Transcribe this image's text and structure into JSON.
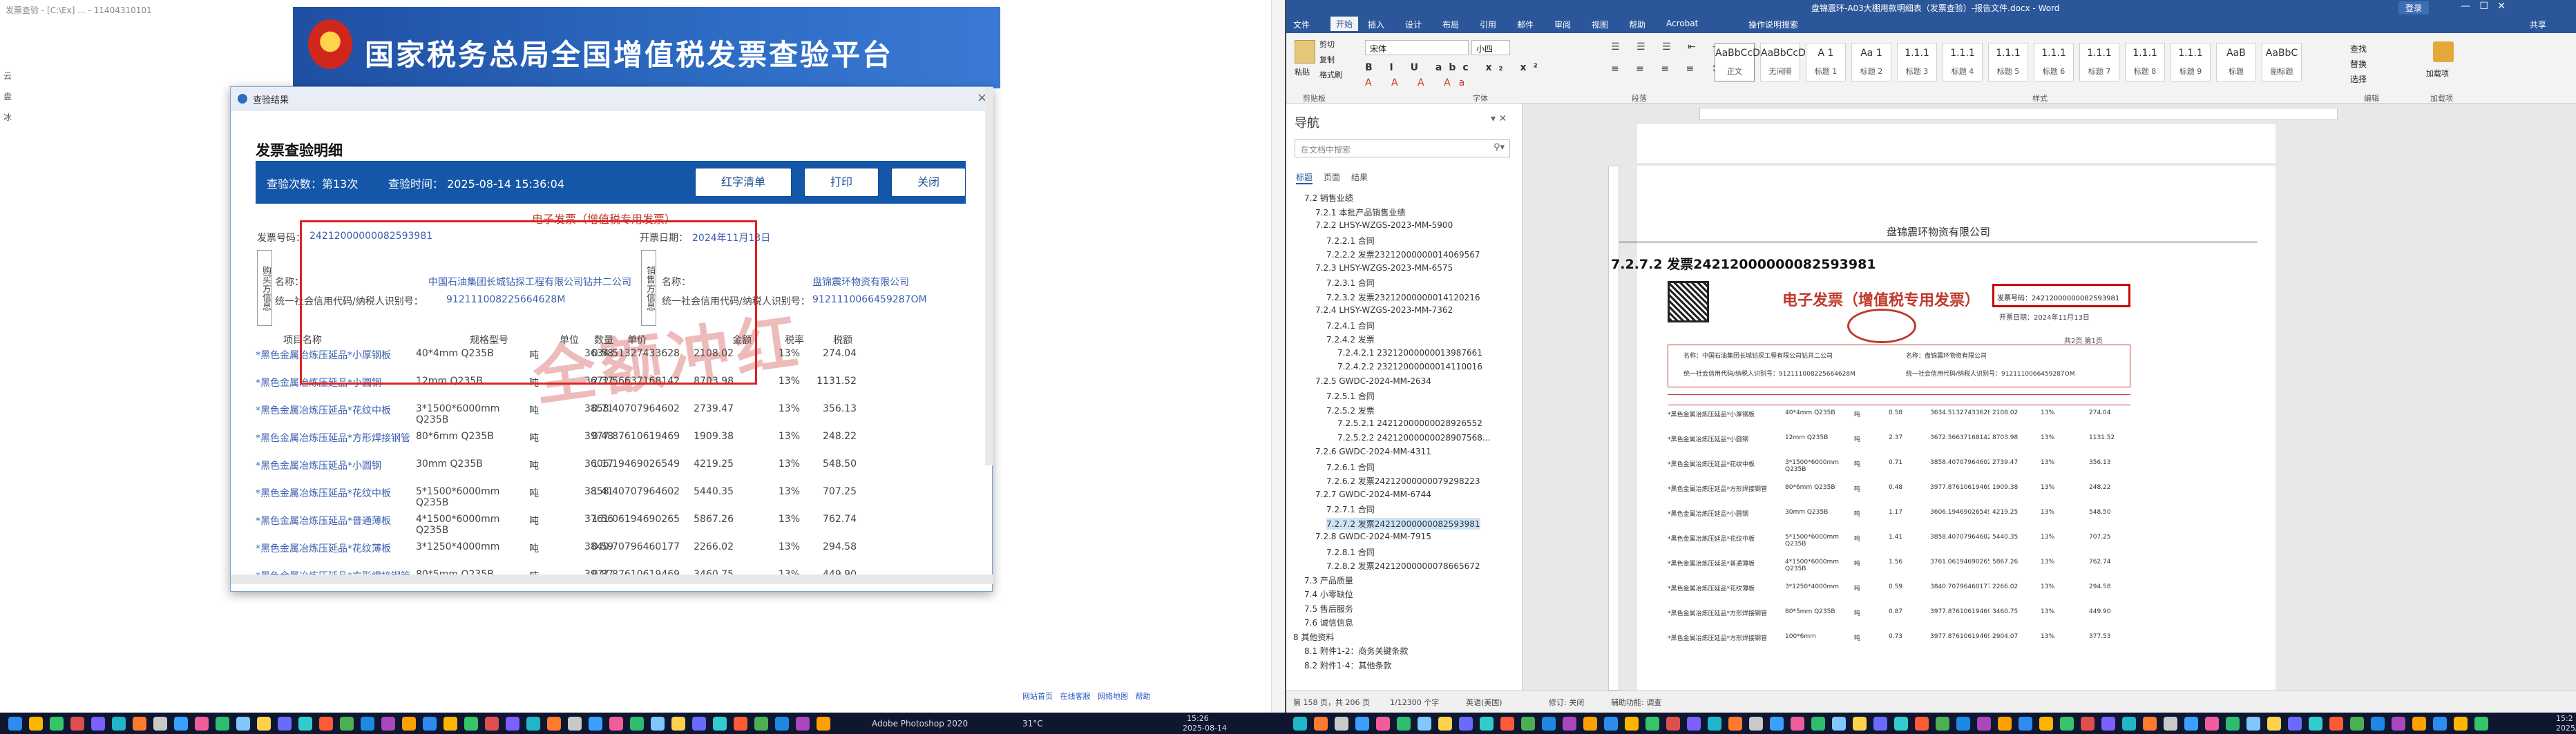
{
  "left_screen": {
    "snippet_text": "发票查验 - [C:\\Ex] ... - 11404310101",
    "side_icons": [
      "云",
      "盘",
      "冰"
    ],
    "banner_title": "国家税务总局全国增值税发票查验平台",
    "dialog": {
      "window_title": "查验结果",
      "close_glyph": "×",
      "heading": "发票查验明细",
      "check_count": "查验次数：第13次",
      "check_time": "查验时间：  2025-08-14 15:36:04",
      "buttons": [
        "红字清单",
        "打印",
        "关闭"
      ],
      "invoice": {
        "title": "电子发票（增值税专用发票）",
        "number_label": "发票号码：",
        "number": "24212000000082593981",
        "date_label": "开票日期：",
        "date": "2024年11月13日",
        "buyer_section": "购买方信息",
        "seller_section": "销售方信息",
        "name_label": "名称：",
        "buyer_name": "中国石油集团长城钻探工程有限公司钻井二公司",
        "seller_name": "盘锦震环物资有限公司",
        "tax_label": "统一社会信用代码/纳税人识别号：",
        "buyer_tax_id": "912111008225664628M",
        "seller_tax_id": "9121110066459287OM",
        "stamp": "全额冲红",
        "columns": [
          "项目名称",
          "规格型号",
          "单位",
          "数量",
          "单价",
          "金额",
          "税率",
          "税额"
        ],
        "rows": [
          {
            "name": "*黑色金属冶炼压延品*小厚钢板",
            "spec": "40*4mm Q235B",
            "unit": "吨",
            "qty": "0.58",
            "price": "3634.51327433628",
            "amount": "2108.02",
            "rate": "13%",
            "tax": "274.04"
          },
          {
            "name": "*黑色金属冶炼压延品*小圆钢",
            "spec": "12mm Q235B",
            "unit": "吨",
            "qty": "2.37",
            "price": "3672.56637168142",
            "amount": "8703.98",
            "rate": "13%",
            "tax": "1131.52"
          },
          {
            "name": "*黑色金属冶炼压延品*花纹中板",
            "spec": "3*1500*6000mm Q235B",
            "unit": "吨",
            "qty": "0.71",
            "price": "3858.40707964602",
            "amount": "2739.47",
            "rate": "13%",
            "tax": "356.13"
          },
          {
            "name": "*黑色金属冶炼压延品*方形焊接钢管",
            "spec": "80*6mm Q235B",
            "unit": "吨",
            "qty": "0.48",
            "price": "3977.87610619469",
            "amount": "1909.38",
            "rate": "13%",
            "tax": "248.22"
          },
          {
            "name": "*黑色金属冶炼压延品*小圆钢",
            "spec": "30mm Q235B",
            "unit": "吨",
            "qty": "1.17",
            "price": "3606.19469026549",
            "amount": "4219.25",
            "rate": "13%",
            "tax": "548.50"
          },
          {
            "name": "*黑色金属冶炼压延品*花纹中板",
            "spec": "5*1500*6000mm Q235B",
            "unit": "吨",
            "qty": "1.41",
            "price": "3858.40707964602",
            "amount": "5440.35",
            "rate": "13%",
            "tax": "707.25"
          },
          {
            "name": "*黑色金属冶炼压延品*普通薄板",
            "spec": "4*1500*6000mm Q235B",
            "unit": "吨",
            "qty": "1.56",
            "price": "3761.06194690265",
            "amount": "5867.26",
            "rate": "13%",
            "tax": "762.74"
          },
          {
            "name": "*黑色金属冶炼压延品*花纹薄板",
            "spec": "3*1250*4000mm",
            "unit": "吨",
            "qty": "0.59",
            "price": "3840.70796460177",
            "amount": "2266.02",
            "rate": "13%",
            "tax": "294.58"
          },
          {
            "name": "*黑色金属冶炼压延品*方形焊接钢管",
            "spec": "80*5mm Q235B",
            "unit": "吨",
            "qty": "0.87",
            "price": "3977.87610619469",
            "amount": "3460.75",
            "rate": "13%",
            "tax": "449.90"
          },
          {
            "name": "*黑色金属冶炼压延品*方形焊接钢管",
            "spec": "100*6mm",
            "unit": "吨",
            "qty": "0.73",
            "price": "3977.87610619469",
            "amount": "2904.07",
            "rate": "13%",
            "tax": "377.53"
          }
        ]
      }
    },
    "status_links": [
      "网站首页",
      "在线客服",
      "网络地图",
      "帮助"
    ]
  },
  "word": {
    "window_title": "盘锦震环-A03大棚用款明细表（发票查验）-报告文件.docx - Word",
    "tabs": [
      "文件",
      "开始",
      "插入",
      "设计",
      "布局",
      "引用",
      "邮件",
      "审阅",
      "视图",
      "帮助",
      "Acrobat",
      "操作说明搜索"
    ],
    "active_tab": "开始",
    "login": "登录",
    "share": "共享",
    "clipboard": {
      "paste": "粘贴",
      "cut": "剪切",
      "copy": "复制",
      "format_painter": "格式刷"
    },
    "font_name": "宋体",
    "font_size": "小四",
    "group_labels": [
      "剪贴板",
      "字体",
      "段落",
      "样式",
      "编辑",
      "加载项"
    ],
    "styles": [
      {
        "preview": "AaBbCcDd",
        "name": "正文"
      },
      {
        "preview": "AaBbCcDd",
        "name": "无间隔"
      },
      {
        "preview": "A 1",
        "name": "标题 1"
      },
      {
        "preview": "Aa 1",
        "name": "标题 2"
      },
      {
        "preview": "1.1.1",
        "name": "标题 3"
      },
      {
        "preview": "1.1.1",
        "name": "标题 4"
      },
      {
        "preview": "1.1.1",
        "name": "标题 5"
      },
      {
        "preview": "1.1.1",
        "name": "标题 6"
      },
      {
        "preview": "1.1.1",
        "name": "标题 7"
      },
      {
        "preview": "1.1.1",
        "name": "标题 8"
      },
      {
        "preview": "1.1.1",
        "name": "标题 9"
      },
      {
        "preview": "AaB",
        "name": "标题"
      },
      {
        "preview": "AaBbC",
        "name": "副标题"
      }
    ],
    "editing": [
      "查找",
      "替换",
      "选择"
    ],
    "addins": "加载项",
    "nav": {
      "title": "导航",
      "search_placeholder": "在文档中搜索",
      "tabs": [
        "标题",
        "页面",
        "结果"
      ],
      "items": [
        {
          "level": 1,
          "text": "7.2 销售业绩",
          "sel": false
        },
        {
          "level": 2,
          "text": "7.2.1 本批产品销售业绩",
          "sel": false
        },
        {
          "level": 2,
          "text": "7.2.2 LHSY-WZGS-2023-MM-5900",
          "sel": false
        },
        {
          "level": 3,
          "text": "7.2.2.1 合同",
          "sel": false
        },
        {
          "level": 3,
          "text": "7.2.2.2 发票23212000000014069567",
          "sel": false
        },
        {
          "level": 2,
          "text": "7.2.3 LHSY-WZGS-2023-MM-6575",
          "sel": false
        },
        {
          "level": 3,
          "text": "7.2.3.1 合同",
          "sel": false
        },
        {
          "level": 3,
          "text": "7.2.3.2 发票23212000000014120216",
          "sel": false
        },
        {
          "level": 2,
          "text": "7.2.4 LHSY-WZGS-2023-MM-7362",
          "sel": false
        },
        {
          "level": 3,
          "text": "7.2.4.1 合同",
          "sel": false
        },
        {
          "level": 3,
          "text": "7.2.4.2 发票",
          "sel": false
        },
        {
          "level": 4,
          "text": "7.2.4.2.1 23212000000013987661",
          "sel": false
        },
        {
          "level": 4,
          "text": "7.2.4.2.2 23212000000014110016",
          "sel": false
        },
        {
          "level": 2,
          "text": "7.2.5 GWDC-2024-MM-2634",
          "sel": false
        },
        {
          "level": 3,
          "text": "7.2.5.1 合同",
          "sel": false
        },
        {
          "level": 3,
          "text": "7.2.5.2 发票",
          "sel": false
        },
        {
          "level": 4,
          "text": "7.2.5.2.1 24212000000028926552",
          "sel": false
        },
        {
          "level": 4,
          "text": "7.2.5.2.2 24212000000028907568...",
          "sel": false
        },
        {
          "level": 2,
          "text": "7.2.6 GWDC-2024-MM-4311",
          "sel": false
        },
        {
          "level": 3,
          "text": "7.2.6.1 合同",
          "sel": false
        },
        {
          "level": 3,
          "text": "7.2.6.2 发票24212000000079298223",
          "sel": false
        },
        {
          "level": 2,
          "text": "7.2.7 GWDC-2024-MM-6744",
          "sel": false
        },
        {
          "level": 3,
          "text": "7.2.7.1 合同",
          "sel": false
        },
        {
          "level": 3,
          "text": "7.2.7.2 发票24212000000082593981",
          "sel": true
        },
        {
          "level": 2,
          "text": "7.2.8 GWDC-2024-MM-7915",
          "sel": false
        },
        {
          "level": 3,
          "text": "7.2.8.1 合同",
          "sel": false
        },
        {
          "level": 3,
          "text": "7.2.8.2 发票24212000000078665672",
          "sel": false
        },
        {
          "level": 1,
          "text": "7.3 产品质量",
          "sel": false
        },
        {
          "level": 1,
          "text": "7.4 小零缺位",
          "sel": false
        },
        {
          "level": 1,
          "text": "7.5 售后服务",
          "sel": false
        },
        {
          "level": 1,
          "text": "7.6 诚信信息",
          "sel": false
        },
        {
          "level": 0,
          "text": "8 其他资料",
          "sel": false
        },
        {
          "level": 1,
          "text": "8.1 附件1-2：商务关键条款",
          "sel": false
        },
        {
          "level": 1,
          "text": "8.2 附件1-4：其他条款",
          "sel": false
        }
      ]
    },
    "doc": {
      "header_company": "盘锦震环物资有限公司",
      "heading": "7.2.7.2 发票24212000000082593981",
      "invoice_image": {
        "title": "电子发票（增值税专用发票）",
        "number_label": "发票号码：",
        "number": "24212000000082593981",
        "date": "开票日期：2024年11月13日",
        "buyer": "名称：中国石油集团长城钻探工程有限公司钻井二公司",
        "seller": "名称：盘锦震环物资有限公司",
        "buyer_tax": "统一社会信用代码/纳税人识别号：912111008225664628M",
        "seller_tax": "统一社会信用代码/纳税人识别号：9121110066459287OM",
        "page": "共2页 第1页"
      }
    },
    "status": {
      "page": "第 158 页，共 206 页",
      "words": "1/12300 个字",
      "ime": "英语(美国)",
      "track": "修订: 关闭",
      "access": "辅助功能: 调查"
    }
  },
  "taskbar": {
    "photoshop_label": "Adobe Photoshop 2020",
    "weather": "31°C",
    "time": "15:26",
    "date": "2025-08-14",
    "time_right": "15:2",
    "date_right": "2025/"
  }
}
